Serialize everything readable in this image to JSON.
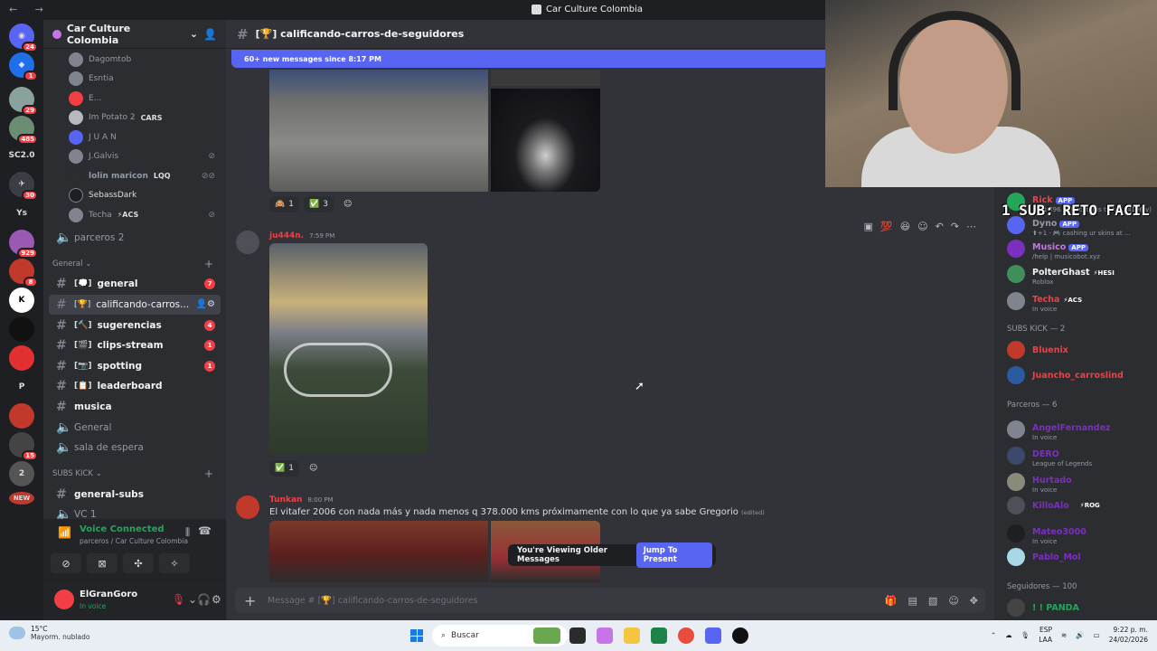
{
  "window": {
    "nav": "← →",
    "title": "Car Culture Colombia"
  },
  "rail": {
    "badges": [
      "24",
      "1",
      "29",
      "485",
      "30",
      "929",
      "8",
      "15",
      "NEW"
    ],
    "labels": [
      "SC2.0",
      "Ys",
      "P"
    ]
  },
  "server": {
    "name": "Car Culture Colombia"
  },
  "voice_members": [
    {
      "name": "Dagomtob",
      "tag": ""
    },
    {
      "name": "Esntia",
      "tag": ""
    },
    {
      "name": "E...",
      "tag": ""
    },
    {
      "name": "Im Potato 2",
      "tag": "CARS"
    },
    {
      "name": "J U A N",
      "tag": ""
    },
    {
      "name": "J.Galvis",
      "tag": ""
    },
    {
      "name": "lolin maricon",
      "tag": "LQQ"
    },
    {
      "name": "SebassDark",
      "tag": ""
    },
    {
      "name": "Techa",
      "tag": "⚡ACS"
    }
  ],
  "channels_top": [
    {
      "name": "parceros 2",
      "type": "voice"
    }
  ],
  "category_general": "General",
  "channels": [
    {
      "name": "general",
      "emoji": "[💭]",
      "count": "7",
      "state": "unread"
    },
    {
      "name": "calificando-carros...",
      "emoji": "[🏆]",
      "count": "",
      "state": "active"
    },
    {
      "name": "sugerencias",
      "emoji": "[🔨]",
      "count": "4",
      "state": "unread"
    },
    {
      "name": "clips-stream",
      "emoji": "[🎬]",
      "count": "1",
      "state": "unread"
    },
    {
      "name": "spotting",
      "emoji": "[📷]",
      "count": "1",
      "state": "unread"
    },
    {
      "name": "leaderboard",
      "emoji": "[📋]",
      "count": "",
      "state": "unread"
    },
    {
      "name": "musica",
      "emoji": "",
      "count": "",
      "state": "unread"
    },
    {
      "name": "General",
      "emoji": "",
      "count": "",
      "state": "voice"
    },
    {
      "name": "sala de espera",
      "emoji": "",
      "count": "",
      "state": "voice"
    }
  ],
  "category_subs": "SUBS KICK",
  "channels_subs": [
    {
      "name": "general-subs",
      "state": "unread"
    },
    {
      "name": "VC 1",
      "state": "voice"
    }
  ],
  "voice": {
    "title": "Voice Connected",
    "subtitle": "parceros / Car Culture Colombia"
  },
  "user": {
    "name": "ElGranGoro",
    "status": "In voice"
  },
  "chat": {
    "channel": "[🏆] calificando-carros-de-seguidores",
    "new_messages": "60+ new messages since 8:17 PM",
    "reactions1": [
      {
        "emoji": "🙈",
        "count": "1"
      },
      {
        "emoji": "✅",
        "count": "3"
      }
    ],
    "msg2": {
      "author": "ju444n.",
      "time": "7:59 PM"
    },
    "reactions2": [
      {
        "emoji": "✅",
        "count": "1"
      }
    ],
    "msg3": {
      "author": "Tunkan",
      "time": "8:00 PM",
      "text": "El vitafer 2006 con nada más y nada menos q 378.000 kms próximamente con lo que ya sabe Gregorio",
      "edited": "(edited)"
    },
    "older_label": "You're Viewing Older Messages",
    "jump_label": "Jump To Present",
    "composer_placeholder": "Message # [🏆] calificando-carros-de-seguidores"
  },
  "overlay": {
    "text": "1 SUB: RETO FACIL"
  },
  "members": {
    "top": [
      {
        "name": "Rick",
        "tag": "APP",
        "sub": "Sent 496 notifications today. (4196 y)",
        "color": "#f23f43"
      },
      {
        "name": "Dyno",
        "tag": "APP",
        "sub": "⬆+1 · 🎮 cashing ur skins at ...",
        "color": "#949ba4"
      },
      {
        "name": "Musico",
        "tag": "APP",
        "sub": "/help | musicobot.xyz",
        "color": "#c774e8"
      },
      {
        "name": "PolterGhast",
        "tag": "⚡HESI",
        "sub": "Roblox",
        "color": "#f2f3f5"
      },
      {
        "name": "Techa",
        "tag": "⚡ACS",
        "sub": "In voice",
        "color": "#f23f43"
      }
    ],
    "section_subs": "SUBS KICK — 2",
    "subs": [
      {
        "name": "Bluenix",
        "color": "#f23f43"
      },
      {
        "name": "Juancho_carroslind",
        "color": "#f23f43"
      }
    ],
    "section_parceros": "Parceros — 6",
    "parceros": [
      {
        "name": "AngelFernandez",
        "sub": "In voice",
        "color": "#7b2fbf"
      },
      {
        "name": "DERO",
        "sub": "League of Legends",
        "color": "#7b2fbf"
      },
      {
        "name": "Hurtado",
        "sub": "In voice",
        "color": "#7b2fbf"
      },
      {
        "name": "KilloAlo",
        "sub": "",
        "tag": "⚡ROG",
        "color": "#7b2fbf"
      },
      {
        "name": "Mateo3000",
        "sub": "In voice",
        "color": "#7b2fbf"
      },
      {
        "name": "Pablo_Mol",
        "sub": "",
        "color": "#7b2fbf"
      }
    ],
    "section_seguidores": "Seguidores — 100",
    "seguidores": [
      {
        "name": "! ! PANDA",
        "color": "#23a55a"
      }
    ]
  },
  "taskbar": {
    "temp": "15°C",
    "weather": "Mayorm. nublado",
    "search": "Buscar",
    "lang1": "ESP",
    "lang2": "LAA",
    "time": "9:22 p. m.",
    "date": "24/02/2026"
  }
}
